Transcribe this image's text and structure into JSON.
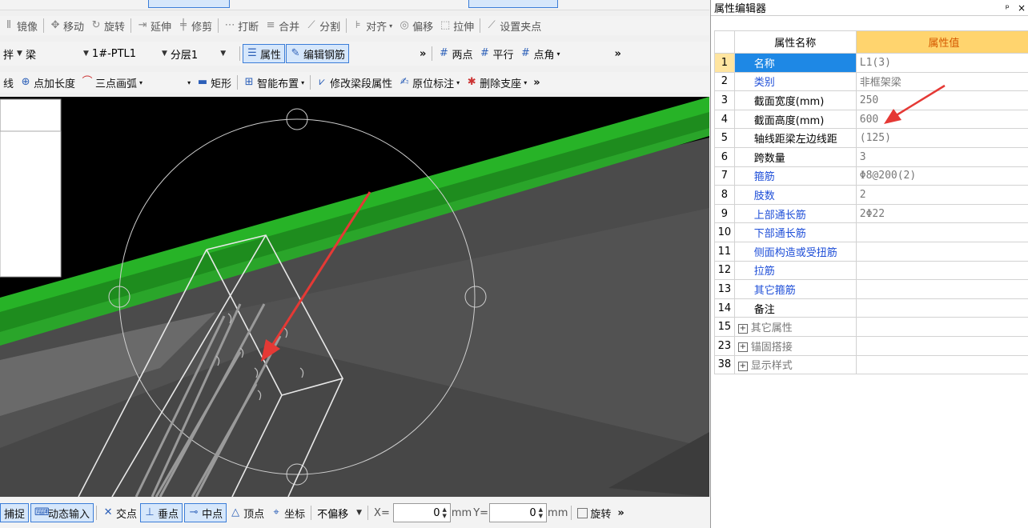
{
  "toolbar1": {
    "items": [
      "镜像",
      "移动",
      "旋转",
      "延伸",
      "修剪",
      "打断",
      "合并",
      "分割",
      "对齐",
      "偏移",
      "拉伸",
      "设置夹点"
    ]
  },
  "toolbar2": {
    "category_suffix": "拌",
    "type_select": "梁",
    "component_select": "1#-PTL1",
    "layer_select": "分层1",
    "property_btn": "属性",
    "edit_rebar_btn": "编辑钢筋",
    "two_points": "两点",
    "parallel": "平行",
    "point_angle": "点角"
  },
  "toolbar3": {
    "line_suffix": "线",
    "point_length": "点加长度",
    "three_point_arc": "三点画弧",
    "rectangle": "矩形",
    "smart_layout": "智能布置",
    "modify_segment": "修改梁段属性",
    "in_situ_mark": "原位标注",
    "delete_support": "删除支座"
  },
  "statusbar": {
    "snap_suffix": "捕捉",
    "dynamic_input": "动态输入",
    "intersection": "交点",
    "perpendicular": "垂点",
    "midpoint": "中点",
    "vertex": "顶点",
    "coordinate": "坐标",
    "offset_select": "不偏移",
    "x_label": "X=",
    "x_value": "0",
    "y_label": "Y=",
    "y_value": "0",
    "unit": "mm",
    "rotate": "旋转"
  },
  "panel": {
    "title": "属性编辑器",
    "pin": "ᵖ",
    "close": "×",
    "header_name": "属性名称",
    "header_value": "属性值",
    "rows": [
      {
        "idx": "1",
        "name": "名称",
        "value": "L1(3)",
        "style": "selected"
      },
      {
        "idx": "2",
        "name": "类别",
        "value": "非框架梁",
        "style": "blue"
      },
      {
        "idx": "3",
        "name": "截面宽度(mm)",
        "value": "250",
        "style": "black"
      },
      {
        "idx": "4",
        "name": "截面高度(mm)",
        "value": "600",
        "style": "black"
      },
      {
        "idx": "5",
        "name": "轴线距梁左边线距",
        "value": "(125)",
        "style": "black"
      },
      {
        "idx": "6",
        "name": "跨数量",
        "value": "3",
        "style": "black"
      },
      {
        "idx": "7",
        "name": "箍筋",
        "value": "Φ8@200(2)",
        "style": "blue"
      },
      {
        "idx": "8",
        "name": "肢数",
        "value": "2",
        "style": "blue"
      },
      {
        "idx": "9",
        "name": "上部通长筋",
        "value": "2Φ22",
        "style": "blue"
      },
      {
        "idx": "10",
        "name": "下部通长筋",
        "value": "",
        "style": "blue"
      },
      {
        "idx": "11",
        "name": "侧面构造或受扭筋",
        "value": "",
        "style": "blue"
      },
      {
        "idx": "12",
        "name": "拉筋",
        "value": "",
        "style": "blue"
      },
      {
        "idx": "13",
        "name": "其它箍筋",
        "value": "",
        "style": "blue"
      },
      {
        "idx": "14",
        "name": "备注",
        "value": "",
        "style": "black"
      },
      {
        "idx": "15",
        "name": "其它属性",
        "value": "",
        "style": "group"
      },
      {
        "idx": "23",
        "name": "锚固搭接",
        "value": "",
        "style": "group"
      },
      {
        "idx": "38",
        "name": "显示样式",
        "value": "",
        "style": "group"
      }
    ]
  },
  "colors": {
    "accent_blue": "#1e88e5",
    "header_value_bg": "#ffd46e",
    "beam_green": "#27b327",
    "annotation_red": "#e53935"
  }
}
